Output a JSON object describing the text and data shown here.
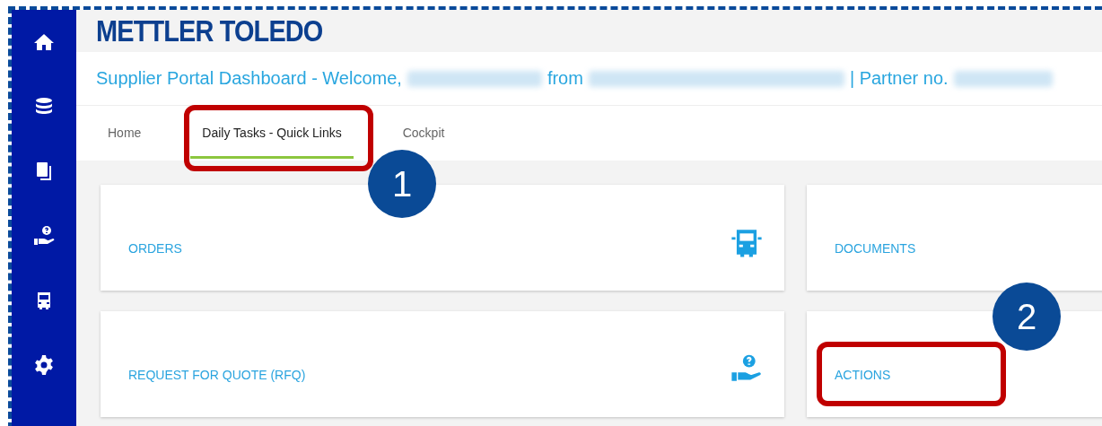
{
  "header": {
    "logo": "METTLER TOLEDO",
    "welcome": [
      {
        "kind": "text",
        "text": "Supplier Portal Dashboard - Welcome,"
      },
      {
        "kind": "redacted"
      },
      {
        "kind": "text",
        "text": "from"
      },
      {
        "kind": "redacted"
      },
      {
        "kind": "text",
        "text": "| Partner no."
      },
      {
        "kind": "redacted"
      }
    ]
  },
  "tabs": [
    {
      "label": "Home",
      "selected": false
    },
    {
      "label": "Daily Tasks - Quick Links",
      "selected": true
    },
    {
      "label": "Cockpit",
      "selected": false
    }
  ],
  "cards": [
    {
      "label": "ORDERS",
      "kind": "truck"
    },
    {
      "label": "DOCUMENTS",
      "kind": "plain"
    },
    {
      "label": "REQUEST FOR QUOTE (RFQ)",
      "kind": "hand"
    },
    {
      "label": "ACTIONS",
      "kind": "plain"
    }
  ],
  "callouts": [
    {
      "number": "1"
    },
    {
      "number": "2"
    }
  ]
}
